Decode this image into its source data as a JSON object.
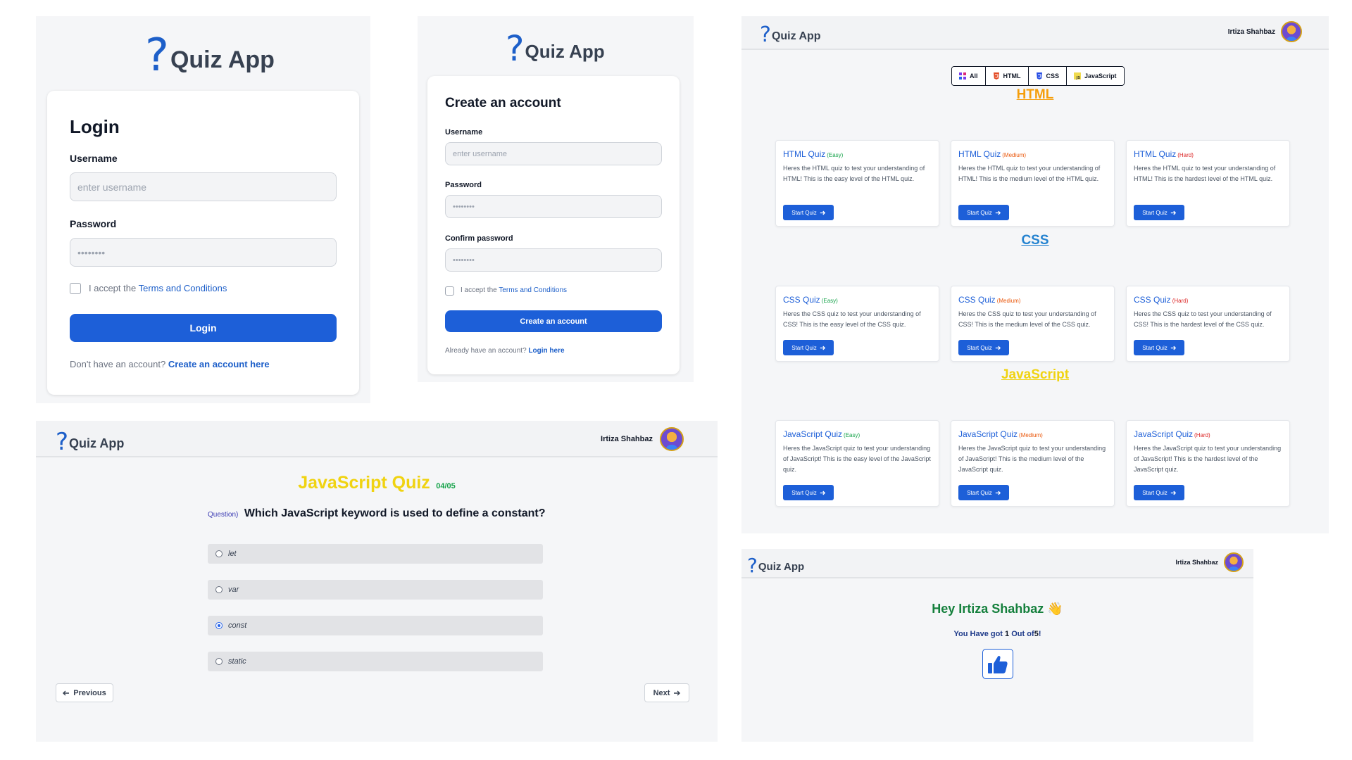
{
  "app": {
    "logo_mark": "?",
    "name": "Quiz App"
  },
  "user": {
    "name": "Irtiza Shahbaz"
  },
  "login": {
    "title": "Login",
    "username_label": "Username",
    "username_placeholder": "enter username",
    "password_label": "Password",
    "password_placeholder": "••••••••",
    "accept_prefix": "I accept the",
    "terms_link": "Terms and Conditions",
    "button": "Login",
    "footer_prefix": "Don't have an account?",
    "footer_link": "Create an account here"
  },
  "create": {
    "title": "Create an account",
    "username_label": "Username",
    "username_placeholder": "enter username",
    "password_label": "Password",
    "password_placeholder": "••••••••",
    "confirm_label": "Confirm password",
    "confirm_placeholder": "••••••••",
    "accept_prefix": "I accept the",
    "terms_link": "Terms and Conditions",
    "button": "Create an account",
    "footer_prefix": "Already have an account?",
    "footer_link": "Login here"
  },
  "quiz": {
    "title": "JavaScript Quiz",
    "progress": "04/05",
    "question_label": "Question)",
    "question": "Which JavaScript keyword is used to define a constant?",
    "options": [
      "let",
      "var",
      "const",
      "static"
    ],
    "selected_index": 2,
    "prev": "Previous",
    "next": "Next"
  },
  "catalog": {
    "filters": [
      {
        "label": "All",
        "color": "#7c3aed"
      },
      {
        "label": "HTML",
        "color": "#e34c26"
      },
      {
        "label": "CSS",
        "color": "#264de4"
      },
      {
        "label": "JavaScript",
        "color": "#f0db4f"
      }
    ],
    "start_label": "Start Quiz",
    "sections": [
      {
        "heading": "HTML",
        "color": "#f59e0b",
        "cards": [
          {
            "title": "HTML Quiz",
            "level": "(Easy)",
            "level_color": "#16a34a",
            "desc": "Heres the HTML quiz to test your understanding of HTML! This is the easy level of the HTML quiz."
          },
          {
            "title": "HTML Quiz",
            "level": "(Medium)",
            "level_color": "#ea580c",
            "desc": "Heres the HTML quiz to test your understanding of HTML! This is the medium level of the HTML quiz."
          },
          {
            "title": "HTML Quiz",
            "level": "(Hard)",
            "level_color": "#dc2626",
            "desc": "Heres the HTML quiz to test your understanding of HTML! This is the hardest level of the HTML quiz."
          }
        ]
      },
      {
        "heading": "CSS",
        "color": "#2583d0",
        "cards": [
          {
            "title": "CSS Quiz",
            "level": "(Easy)",
            "level_color": "#16a34a",
            "desc": "Heres the CSS quiz to test your understanding of CSS! This is the easy level of the CSS quiz."
          },
          {
            "title": "CSS Quiz",
            "level": "(Medium)",
            "level_color": "#ea580c",
            "desc": "Heres the CSS quiz to test your understanding of CSS! This is the medium level of the CSS quiz."
          },
          {
            "title": "CSS Quiz",
            "level": "(Hard)",
            "level_color": "#dc2626",
            "desc": "Heres the CSS quiz to test your understanding of CSS! This is the hardest level of the CSS quiz."
          }
        ]
      },
      {
        "heading": "JavaScript",
        "color": "#f0d311",
        "cards": [
          {
            "title": "JavaScript Quiz",
            "level": "(Easy)",
            "level_color": "#16a34a",
            "desc": "Heres the JavaScript quiz to test your understanding of JavaScript! This is the easy level of the JavaScript quiz."
          },
          {
            "title": "JavaScript Quiz",
            "level": "(Medium)",
            "level_color": "#ea580c",
            "desc": "Heres the JavaScript quiz to test your understanding of JavaScript! This is the medium level of the JavaScript quiz."
          },
          {
            "title": "JavaScript Quiz",
            "level": "(Hard)",
            "level_color": "#dc2626",
            "desc": "Heres the JavaScript quiz to test your understanding of JavaScript! This is the hardest level of the JavaScript quiz."
          }
        ]
      }
    ]
  },
  "result": {
    "greeting_prefix": "Hey",
    "greeting_emoji": "👋",
    "score_prefix": "You Have got",
    "score": "1",
    "score_middle": "Out of",
    "total": "5",
    "score_suffix": "!",
    "icon": "thumbs-up-icon",
    "accent": "#1d5fd8"
  }
}
